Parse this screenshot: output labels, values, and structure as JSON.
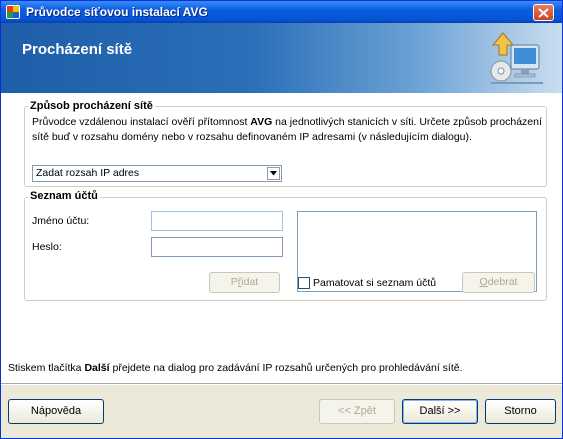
{
  "window": {
    "title": "Průvodce síťovou instalací AVG"
  },
  "banner": {
    "title": "Procházení sítě"
  },
  "browse_group": {
    "legend": "Způsob procházení sítě",
    "desc_1": "Průvodce vzdálenou instalací ověří přítomnost ",
    "desc_bold": "AVG",
    "desc_2": " na jednotlivých stanicích v síti. Určete způsob procházení sítě buď v rozsahu domény nebo v rozsahu definovaném IP adresami (v následujícím dialogu).",
    "select_value": "Zadat rozsah IP adres"
  },
  "accounts_group": {
    "legend": "Seznam účtů",
    "username_label": "Jméno účtu:",
    "username_value": "",
    "password_label": "Heslo:",
    "password_value": "",
    "add_first": "P",
    "add_hot": "ř",
    "add_rest": "idat",
    "remember_label": "Pamatovat si seznam účtů",
    "remove_first": "",
    "remove_hot": "O",
    "remove_rest": "debrat"
  },
  "footer": {
    "text_1": "Stiskem tlačítka ",
    "text_bold": "Další",
    "text_2": " přejdete na dialog pro zadávání IP rozsahů určených pro prohledávání sítě."
  },
  "buttons": {
    "help": "Nápověda",
    "back": "<< Zpět",
    "next": "Další >>",
    "cancel": "Storno"
  }
}
